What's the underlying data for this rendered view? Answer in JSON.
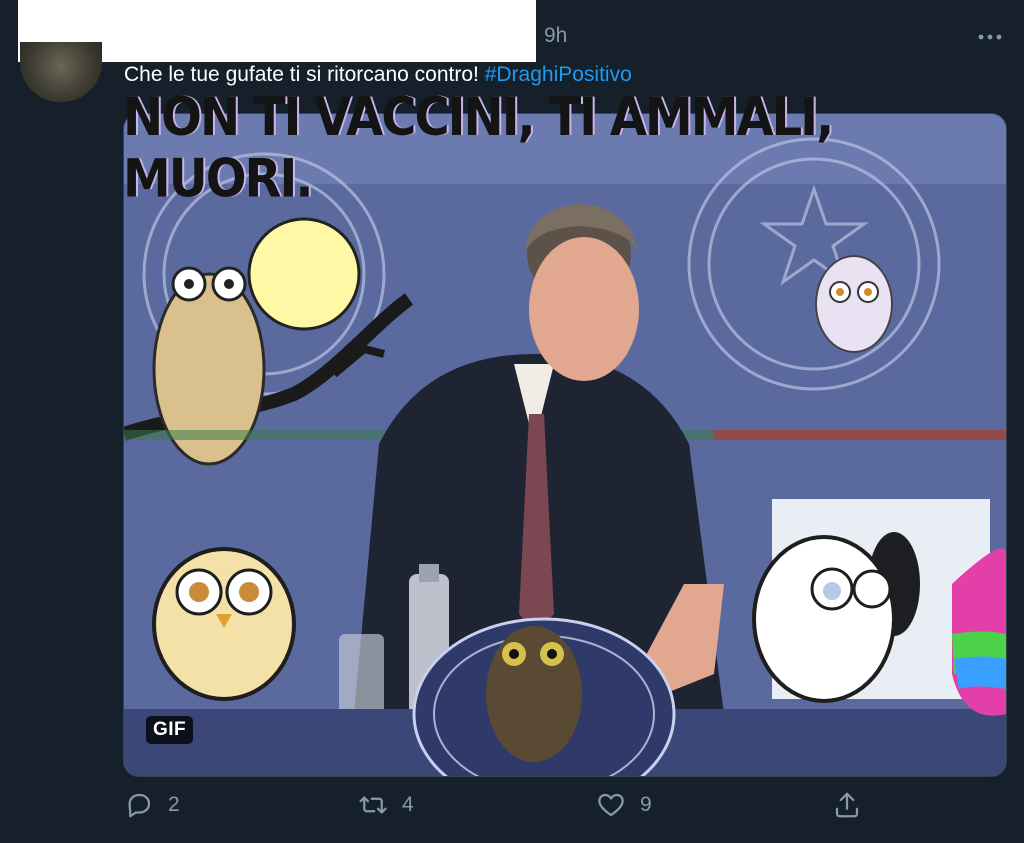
{
  "tweet": {
    "timestamp": "9h",
    "text": "Che le tue gufate ti si ritorcano contro!",
    "hashtag": "#DraghiPositivo"
  },
  "media": {
    "caption": "NON TI VACCINI, TI AMMALI, MUORI.",
    "badge": "GIF"
  },
  "actions": {
    "reply_count": "2",
    "retweet_count": "4",
    "like_count": "9"
  },
  "colors": {
    "background": "#15202b",
    "accent": "#1d9bf0",
    "muted": "#8899a6"
  }
}
